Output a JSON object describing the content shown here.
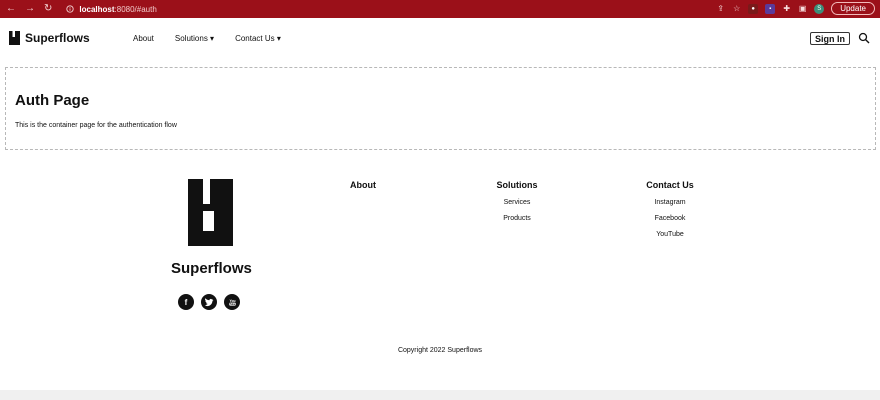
{
  "browser": {
    "url_host": "localhost",
    "url_rest": ":8080/#auth",
    "update_label": "Update",
    "avatar_letter": "S"
  },
  "header": {
    "brand": "Superflows",
    "nav": {
      "about": "About",
      "solutions": "Solutions ▾",
      "contact": "Contact Us ▾"
    },
    "signin_label": "Sign In"
  },
  "main": {
    "title": "Auth Page",
    "description": "This is the container page for the authentication flow"
  },
  "footer": {
    "brand": "Superflows",
    "columns": {
      "about": {
        "heading": "About"
      },
      "solutions": {
        "heading": "Solutions",
        "links": [
          "Services",
          "Products"
        ]
      },
      "contact": {
        "heading": "Contact Us",
        "links": [
          "Instagram",
          "Facebook",
          "YouTube"
        ]
      }
    },
    "copyright": "Copyright 2022 Superflows"
  },
  "icons": {
    "social": [
      "facebook-icon",
      "twitter-icon",
      "youtube-icon"
    ]
  },
  "colors": {
    "chrome": "#9b1019",
    "page_bg": "#ffffff",
    "text": "#111111"
  }
}
